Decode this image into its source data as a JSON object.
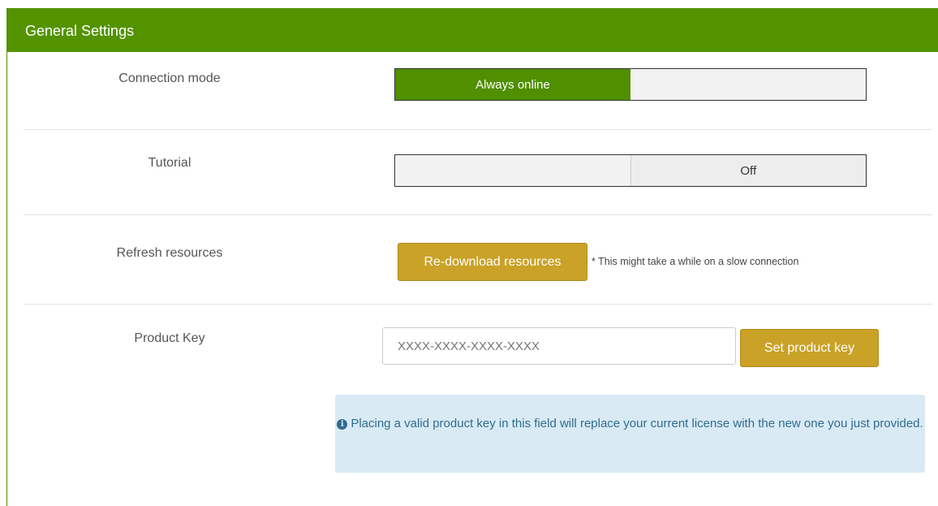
{
  "panel": {
    "title": "General Settings"
  },
  "connection": {
    "label": "Connection mode",
    "options": [
      "Always online",
      ""
    ],
    "selected": "Always online"
  },
  "tutorial": {
    "label": "Tutorial",
    "options": [
      "",
      "Off"
    ],
    "selected": "Off"
  },
  "refresh": {
    "label": "Refresh resources",
    "button": "Re-download resources",
    "note": "* This might take a while on a slow connection"
  },
  "product_key": {
    "label": "Product Key",
    "placeholder": "XXXX-XXXX-XXXX-XXXX",
    "value": "",
    "button": "Set product key",
    "info": "Placing a valid product key in this field will replace your current license with the new one you just provided."
  },
  "icons": {
    "info": "info-circle-icon"
  },
  "colors": {
    "header": "#549300",
    "toggle_on": "#4f8f00",
    "button": "#c9a227",
    "info_bg": "#d9eaf4",
    "info_text": "#2f6c8f"
  }
}
